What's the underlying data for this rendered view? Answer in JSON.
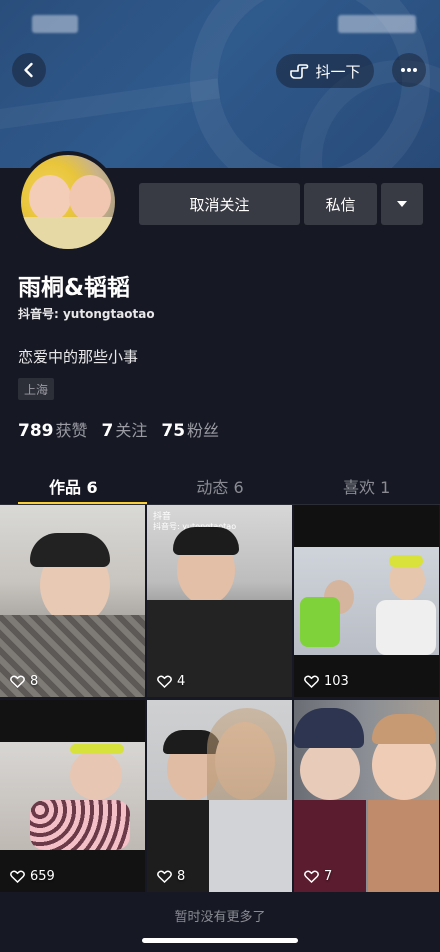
{
  "header": {
    "back_icon": "chevron-left-icon",
    "shake_label": "抖一下",
    "shake_icon": "hand-point-icon",
    "more_icon": "ellipsis-icon"
  },
  "profile": {
    "unfollow_label": "取消关注",
    "message_label": "私信",
    "dropdown_icon": "caret-down-icon",
    "name": "雨桐&韬韬",
    "douyin_id": "抖音号: yutongtaotao",
    "bio": "恋爱中的那些小事",
    "location": "上海",
    "stats": {
      "likes_value": "789",
      "likes_label": "获赞",
      "following_value": "7",
      "following_label": "关注",
      "followers_value": "75",
      "followers_label": "粉丝"
    }
  },
  "tabs": [
    {
      "label": "作品 6",
      "active": true
    },
    {
      "label": "动态 6",
      "active": false
    },
    {
      "label": "喜欢 1",
      "active": false
    }
  ],
  "videos": [
    {
      "likes": "8"
    },
    {
      "likes": "4",
      "watermark": "抖音",
      "watermark_id": "抖音号: yutongtaotao"
    },
    {
      "likes": "103"
    },
    {
      "likes": "659"
    },
    {
      "likes": "8"
    },
    {
      "likes": "7"
    }
  ],
  "footer_text": "暂时没有更多了",
  "colors": {
    "background": "#161823",
    "button": "#393b44",
    "accent_underline": "#facf3a",
    "muted_text": "#8a8b93"
  }
}
